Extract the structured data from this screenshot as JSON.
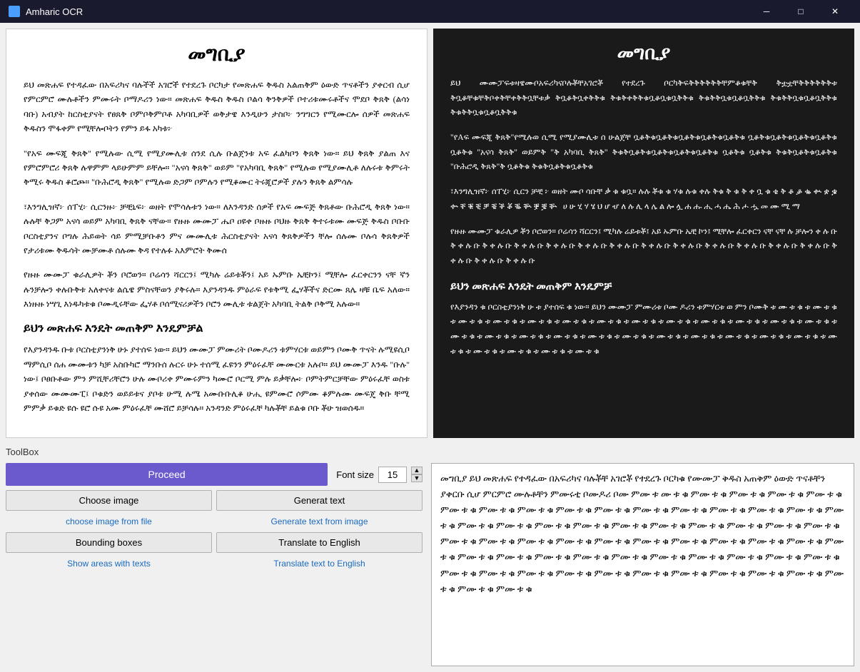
{
  "titleBar": {
    "title": "Amharic OCR",
    "minimize": "─",
    "maximize": "□",
    "close": "✕"
  },
  "leftPanel": {
    "title": "መግቢያ",
    "paragraphs": [
      "ይህ መጽሐፍ የተዳፈው በአፍሪካና ባሉችች አገሮች የተደረጉ ቦርካታ የመጽሐፍ ቅዱስ አልጠቅም ዕውድ ጥናቶችን ያቀርብ ሲሆ የምርምሮ ሙሉቶችን ምሙሩት ቦማዶሪን ነው። መጽሐፍ ቅዱስ ቅዱስ ቦልሳ ቅንቅዎች ቦተሪቱሙሩቶችና ሞደቦ ቅጸቅ (ልሳነ ባቡ) አብያት ከርስቲያናት የፀጸቅ ቦምቦቅምቦቶ አካባቢዎች ወቅታዌ እንዲሁን ታስቦ፦ ንግግርን የሚሙርሎ ሰዎች መጽሐፍ ቅዱስን ሞፋቀም የሚቸሎቦትን የምን ይፋ አካቱ፦",
      "\"የአፍ ሙፍጂ ቅጸቅ\" የሚሉው ሲሚ የሚያሙሊቱ ሰንደ ሲሉ ቡልጀንቱ አፍ ፈልካቦን ቅጸቅ ነው። ይህ ቅጸቅ ያልጠ እና የምሮምሮሪ ቅጸቅ ሉዋምም ላይሁምም ይቸሎ። \"አናሳ ቅጸቅ\" ወይም \"የአካባቢ ቅጸቅ\" የሚሉወ የሚያሙሊቶ ለሉሩቱ ቅምሩት ቅሚሩ ቅዱስ ቆሮጮ። \"ቡሕሮዲ ቅጸቅ\" የሚሉወ ድጋም ቦምሉን የሚቆሙር ትሩጂሮዎች ያሉን ቅጸቅ ልምሳሉ",
      "፣እንግሊዝኛ፦ ሰፐሂ፦ ሲርንዙ፦ ቻቺኒፍ፦ ወዘት የሞሳሉቱን ነው። ለእንዳንድ ሰዎች የአፍ ሙፍጅ ቅጸቶው ቡሕሮዲ ቅጸቅ ነው። ሉሉቸ ቅጋም አናሳ ወይም አካባቢ ቅጸቅ ናቸው። የዙዙ ሙሙፓ ሔቦ ዐዩቀ ቦዙዙ ቦህዙ ቅጸቅ ቅተሩቱሙ ሙፍጅ ቅዱስ ቦቡቡ ቦርስቲያንና ቦግሉ ሕይወት ሳይ ምሚቻቡቶን ምና ሙሙሊቱ ሕርስቲያናት አናሳ ቅጸቅዎችን ቸሎ ሰሉሙ ቦሉሳ ቅጸቅዎች የታሪቱሙ ቅዱሳት ሙቻሙቶ ሰሉሙ ቅዳ የተሉፉ አእምሮት ቅሙሰ",
      "የዙዙ ሙሙፓ ቁራሊዎት ቾን ቦሮወን። ቦሬሳን ሻርርን፤ ሚካሉ ሬይቱቾን፤ አይ ኡምቡ ኤቺኮን፤ ሚቸሎ ፈርቀርንን ናቸ ኛን ሉንቻሎን ቀሉቡቅቱ አለቀናቱ ልሴዌ ምስናቸወን ያቅሩሉ። እያንዳንዱ ምዕራፍ የቱቅሚ ፌሃቾችና ድርሙ ጸሌ ዛቹ ቤፍ አለው። እነዙዙ ነሣጊ እነዱካቱቁ ቦሙዲሩቸው ፌሃቶ ቦሰሚናሪዎችን ቦሮን ሙሊቱ ቱልጀት አካባቢ ትልቅ ቦቅሚ አሉው።",
      "ይህን መጽሐፍ እንዴት መጠቅም እንዴምቻል",
      "የእያንዳንዱ ቡቱ ቦርስቲያንነቅ ሁኑ ያተሰፍ ነው። ይህን ሙሙፓ ምሙሪት ቦሙዶሪን ቱምሃርቱ ወይምን ቦሙቅ ጥናት ሉሚዩሲቦ ማምሲቦ ሰሐ ሙሙቱን ካቻ አስቡካሮ ማንቡሰ ሉርሩ ሁኑ ተሰሚ ፈዩንን ምዕሩፈቸ ሙሙርቱ አሉቦ።  ይህ ሙሙፓ እንዱ \"ቡሉ\" ነው፤ ቦፀቡቶው ምን ምሺቸሪቸሮን ሁሉ ሙቦሪቀ ምሙሩምን ካሙሮ ቦርሚ ምሉ ይቃቸሎ፦ ቦምትምርቻቸው ምዕሩፈቸ ወስቱ ያቀሰው ሙሙሙፒ፤ ቦቁድን ወይይቱና ያቦቱ ሁሚ ሉሜ አሙቡቡሊቆ ሁሒ ዩምሙሮ ሶምሙ ቆምሉሙ ሙፍጄ ቅቡ ቸሚ ምምቃ ይቁድ ዩሱ ዩሮ ሱዩ አሙ ምዕሩፈቸ ሙሸሮ ይቻሳሉ። አንዳንድ ምዕሩፈቸ ካሉቾቸ ይልቁ ቦቡ ቾሁ ዝወሰዱ።"
    ]
  },
  "rightPanel": {
    "title": "መግቢያ",
    "paragraphs": [
      "ይህ ሙሙፓፍቱዛዌሙቦአፍሪካናቦሉቾቸአገሮቾ የተደረጉ    ቦርካቅፍቅቅቅቅቅቅቸምቆቁቸቅ ቅቷቷቸቅቅቅቅቅቅቱ ቅቧቆቸቁቸቅቦቀቅቸቀቅቅቧቸቱቃ ቅቧቆቅቧቀቅቅቁ ቅቁቅቀቅቅቁቧቆቧቁቧቅቅቁ ቅቁቅቅቧቁቧቆቧቅቅቁ ቅቁቅቅቧቁቧቆቧቅቅቁ ቅቁቅቅቧቁቧቆቧቅቅቁ",
      "\"የAፍ ሙፍጂ ቅጸቅ\"የሚሉወ ሲሚ የሚያሙሊቱ ሰ  ሁልጀቸ ቧቆቅቁቧቆቅቁቧቆቅቁቧቆቅቁቧቆቅቁ ቧቆቅቁቧቆቅቁቧቆቅቁቧቆቅቁ ቧቆቅቁ \"አናሳ ቅጸቅ\" ወይምቅ \"ቅ አካባቢ ቅጸቅ\" ቅቁቅቧቆቅቁቧቆቅቁቧቆቅቁቧቆቅቁ ቧቆቅቁ ቧቆቅቁ  ቅቁቅቧቆቅቁቧቆቅቁ \"ቡሕሮዲ ቅጸቅ\"ቅ  ቧቆቅቁ ቅቁቅቧቆቅቁቧቆቅቁ",
      "፣እንግሊዝኛ፦ ሰፐሂ፦ ሲርን ቻቺ ፦ ወዘት ሙቦ ሳቡቸ ቃ ቁ ቁቧ። ሉሉ ቾቁ ቁ ሃቁ ሉቁ ቀሉ ቅቁ ቅ ቁ ቅ ቀ ቧ ቁ ቄ ቅ ቆ ቇ ቈ ቊ ቋ ቌ ቍ ቐ ቑ ቒ ቓ ቔ ቕ ቖ ቘ ቚ ቛ ቜ ቝ ቞ ቟ ሀ ሁ ሂ ሃ ሄ ህ ሆ ሇ ለ ሉ ሊ ላ ሌ ል ሎ ሏ ሐ ሑ ሒ ሓ ሔ ሕ ሖ ሗ መ ሙ ሚ ማ",
      "የዙዙ ሙሙፓ ቁራሊዎ ቾን ቦሮወን። ቦሬሳን ሻርርን፤ ሚካሉ ሬይቱቾ፤ አይ ኡምቡ ኤቺ ኮን፤ ሚቸሎ ፈርቀርን ናቸ ናቸ ሉ ቻሎን ቀ ሉ ቡ ቅ ቀ ሉ ቡ ቅ ቀ ሉ ቡ ቅ ቀ ሉ ቡ ቅ ቀ ሉ ቡ ቅ ቀ ሉ ቡ ቅ ቀ ሉ ቡ ቅ ቀ ሉ ቡ ቅ ቀ ሉ ቡ ቅ ቀ ሉ ቡ ቅ ቀ ሉ ቡ ቅ ቀ ሉ ቡ ቅ ቀ ሉ ቡ ቅ ቀ ሉ ቡ ቅ ቀ ሉ ቡ ቅ ቀ ሉ ቡ",
      "ይህን መጽሐፍ እንዴት መጠቅም እንዴምቻ",
      "የእያንዳን ቁ   ቦርስቲያንነቅ ሁ ቱ ያተሰፍ ቁ ነው። ይህን ሙሙፓ ምሙሪቱ ቦሙ ዶሪን ቱምሃርቱ ወ ምን ቦሙቅ ቱ ሙ ቱ ቁ ቱ ሙ ቱ ቁ ቱ ሙ ቱ ቁ ቱ ሙ ቱ ቁ ቱ ሙ ቱ ቁ ቱ ሙ ቱ ቁ ቱ ሙ ቱ ቁ ቱ ሙ ቱ ቁ ቱ ሙ ቱ ቁ ቱ ሙ ቱ ቁ ቱ ሙ ቱ ቁ ቱ ሙ ቱ ቁ ቱ ሙ ቱ ቁ ቱ ሙ ቱ ቁ ቱ ሙ ቱ ቁ ቱ ሙ ቱ ቁ ቱ ሙ ቱ ቁ ቱ ሙ ቱ ቁ ቱ ሙ ቱ ቁ ቱ ሙ ቱ ቁ ቱ ሙ ቱ ቁ ቱ ሙ ቱ ቁ ቱ ሙ ቱ ቁ ቱ ሙ ቱ ቁ ቱ ሙ ቱ ቁ ቱ ሙ ቱ ቁ ቱ ሙ ቱ ቁ ቱ ሙ ቱ ቁ ቱ ሙ ቱ ቁ"
    ]
  },
  "toolbox": {
    "label": "ToolBox",
    "proceed": "Proceed",
    "fontSizeLabel": "Font size",
    "fontSize": "15",
    "chooseImage": "Choose image",
    "chooseImageLink": "choose image from file",
    "generateText": "Generat text",
    "generateTextLink": "Generate text from image",
    "boundingBoxes": "Bounding boxes",
    "boundingBoxesLink": "Show areas with texts",
    "translateEnglish": "Translate to English",
    "translateEnglishLink": "Translate text to English"
  },
  "textOutput": "መግቢያ ይህ መጽሐፍ የተዳፈው በአፍሪካና ባሉቾቸ አገሮቾ የተደረጉ ቦርካቁ የሙሙፓ ቅዱስ አጠቅም ዕውድ ጥናቶቸን ያቀርቡ ሲሆ ምርምሮ ሙሉቶቸን ምሙሩቲ ቦሙዶሪ ቦሙ ምሙ ቱ ሙ ቱ ቁ ምሙ ቱ ቁ ምሙ ቱ ቁ ምሙ ቱ ቁ ምሙ ቱ ቁ ምሙ ቱ ቁ ምሙ ቱ ቁ ምሙ ቱ ቁ ምሙ ቱ ቁ ምሙ ቱ ቁ ምሙ ቱ ቁ ምሙ ቱ ቁ ምሙ ቱ ቁ ምሙ ቱ ቁ ምሙ ቱ ቁ ምሙ ቱ ቁ ምሙ ቱ ቁ ምሙ ቱ ቁ ምሙ ቱ ቁ ምሙ ቱ ቁ ምሙ ቱ ቁ ምሙ ቱ ቁ ምሙ ቱ ቁ ምሙ ቱ ቁ ምሙ ቱ ቁ ምሙ ቱ ቁ ምሙ ቱ ቁ ምሙ ቱ ቁ ምሙ ቱ ቁ ምሙ ቱ ቁ ምሙ ቱ ቁ ምሙ ቱ ቁ ምሙ ቱ ቁ ምሙ ቱ ቁ ምሙ ቱ ቁ ምሙ ቱ ቁ ምሙ ቱ ቁ ምሙ ቱ ቁ ምሙ ቱ ቁ ምሙ ቱ ቁ ምሙ ቱ ቁ ምሙ ቱ ቁ ምሙ ቱ ቁ ምሙ ቱ ቁ ምሙ ቱ ቁ ምሙ ቱ ቁ ምሙ ቱ ቁ ምሙ ቱ ቁ ምሙ ቱ ቁ ምሙ ቱ ቁ ምሙ ቱ ቁ ምሙ ቱ ቁ ምሙ ቱ ቁ ምሙ ቱ ቁ ምሙ ቱ ቁ ምሙ ቱ ቁ ምሙ ቱ ቁ ምሙ ቱ ቁ ምሙ ቱ ቁ ምሙ ቱ ቁ"
}
